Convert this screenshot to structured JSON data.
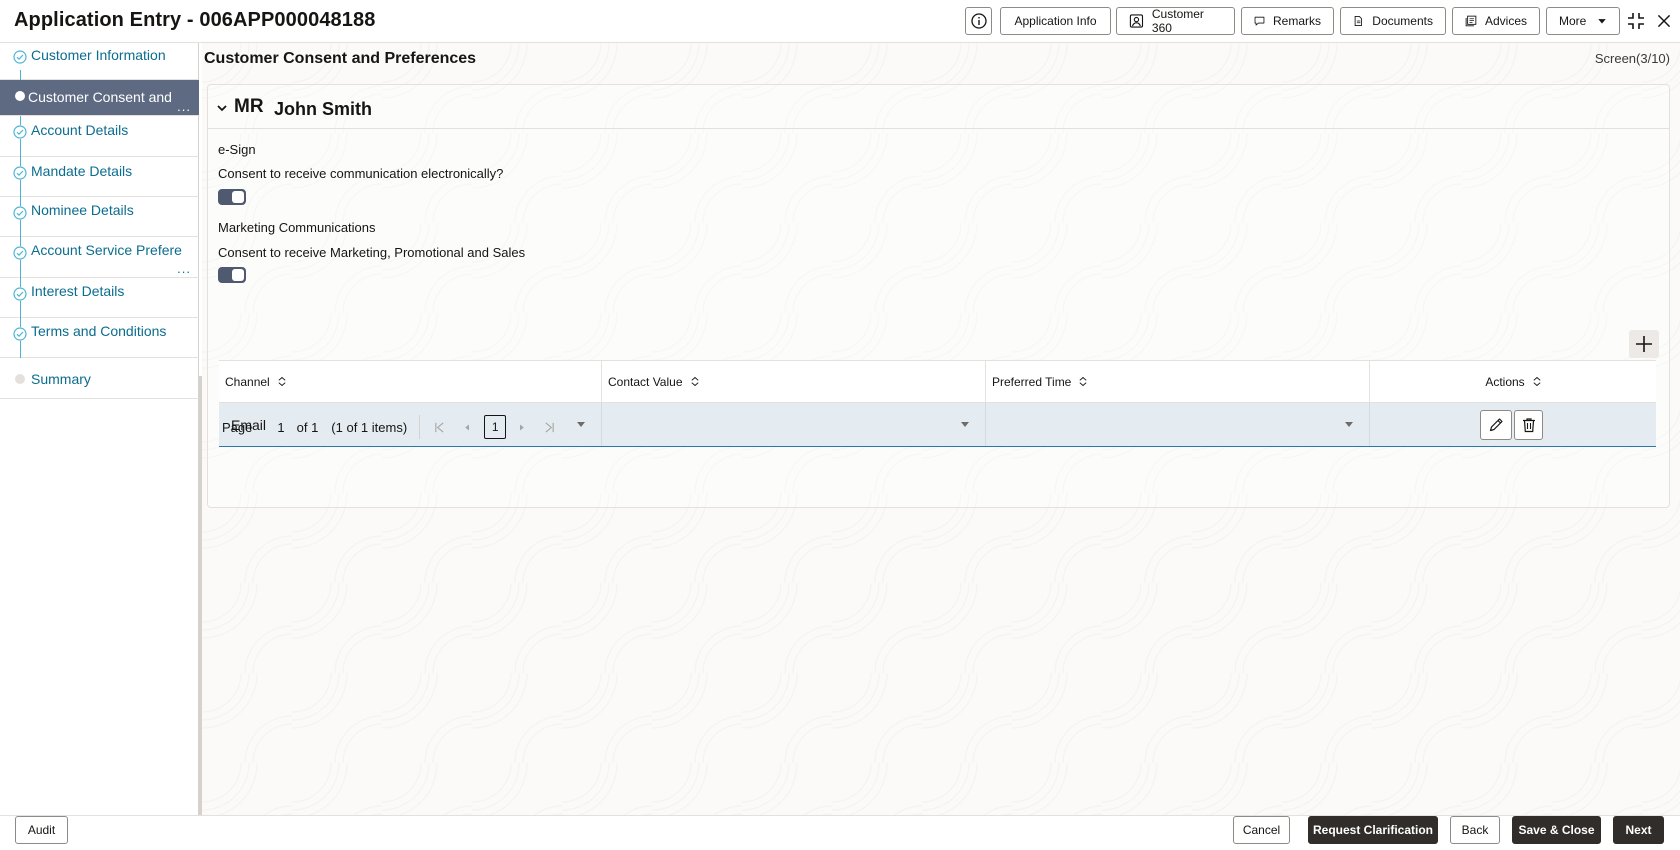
{
  "header": {
    "title": "Application Entry - 006APP000048188",
    "buttons": {
      "application_info": "Application Info",
      "customer_360": "Customer 360",
      "remarks": "Remarks",
      "documents": "Documents",
      "advices": "Advices",
      "more": "More"
    }
  },
  "sidebar": {
    "items": [
      {
        "label": "Customer Information",
        "state": "completed"
      },
      {
        "label": "Customer Consent and",
        "state": "active",
        "more": "..."
      },
      {
        "label": "Account Details",
        "state": "completed"
      },
      {
        "label": "Mandate Details",
        "state": "completed"
      },
      {
        "label": "Nominee Details",
        "state": "completed"
      },
      {
        "label": "Account Service Prefere",
        "state": "completed",
        "more": "..."
      },
      {
        "label": "Interest Details",
        "state": "completed"
      },
      {
        "label": "Terms and Conditions",
        "state": "completed"
      },
      {
        "label": "Summary",
        "state": "pending"
      }
    ]
  },
  "main": {
    "page_title": "Customer Consent and Preferences",
    "screen_indicator": "Screen(3/10)",
    "customer": {
      "salutation": "MR",
      "name": "John Smith"
    },
    "esign": {
      "section_label": "e-Sign",
      "consent_label": "Consent to receive communication electronically?",
      "consent_on": true
    },
    "marketing": {
      "section_label": "Marketing Communications",
      "consent_label": "Consent to receive Marketing, Promotional and Sales",
      "consent_on": true
    },
    "table": {
      "columns": [
        "Channel",
        "Contact Value",
        "Preferred Time",
        "Actions"
      ],
      "rows": [
        {
          "channel": "Email",
          "contact_value": "",
          "preferred_time": ""
        }
      ]
    },
    "pager": {
      "page_label": "Page",
      "page_value": "1",
      "of_label": "of 1",
      "items_label": "(1 of 1 items)",
      "current_page": "1"
    }
  },
  "footer": {
    "audit": "Audit",
    "cancel": "Cancel",
    "request_clarification": "Request Clarification",
    "back": "Back",
    "save_close": "Save & Close",
    "next": "Next"
  },
  "colors": {
    "link": "#0b6d8f",
    "active_step": "#5d6a82",
    "toggle_on": "#4f5a70",
    "row_selected": "#e4ebf1",
    "primary_button": "#312d2a"
  }
}
